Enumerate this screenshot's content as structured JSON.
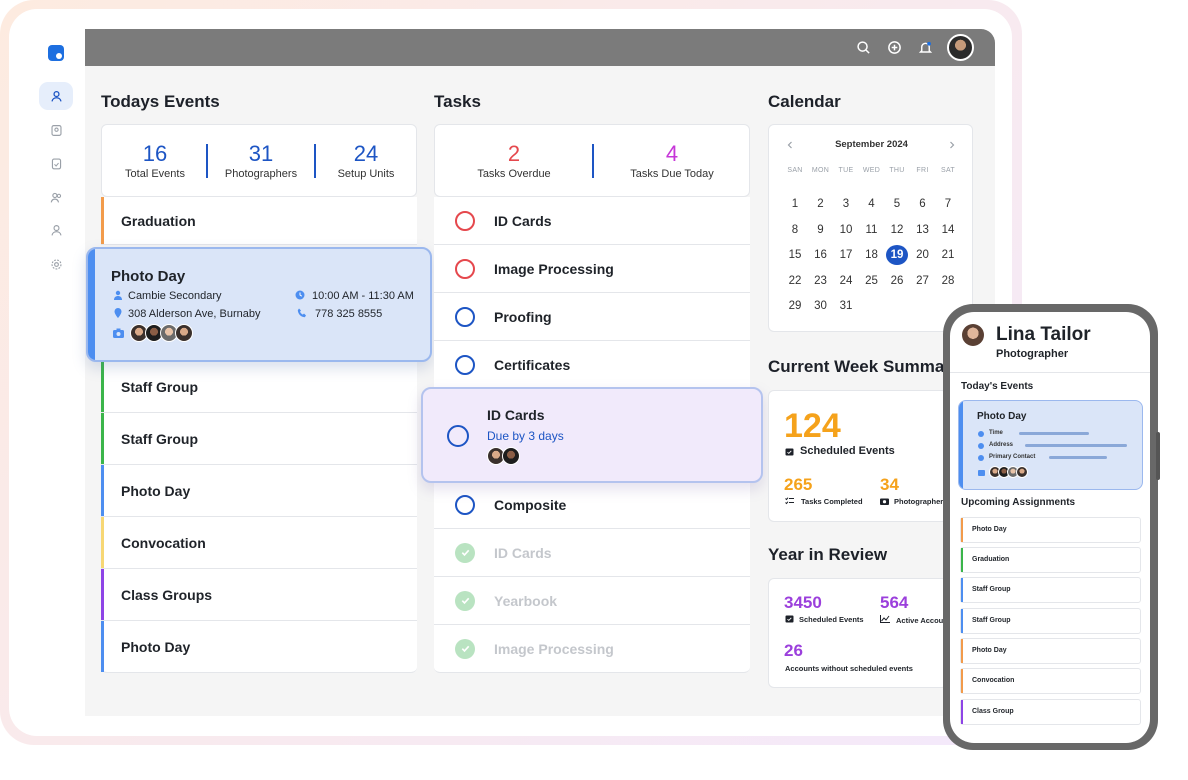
{
  "nav": {
    "items": [
      "user-icon",
      "id-badge-icon",
      "clipboard-icon",
      "users-icon",
      "person-icon",
      "gear-icon"
    ]
  },
  "topbar": {
    "icons": [
      "search-icon",
      "plus-circle-icon",
      "bell-icon"
    ]
  },
  "events": {
    "title": "Todays Events",
    "stats": [
      {
        "value": "16",
        "label": "Total Events"
      },
      {
        "value": "31",
        "label": "Photographers"
      },
      {
        "value": "24",
        "label": "Setup Units"
      }
    ],
    "rows": [
      {
        "label": "Graduation",
        "color": "#f29b4b"
      },
      {
        "label": "Staff Group",
        "color": "#3bb54a"
      },
      {
        "label": "Staff Group",
        "color": "#3bb54a"
      },
      {
        "label": "Photo Day",
        "color": "#4d8ef0"
      },
      {
        "label": "Convocation",
        "color": "#f7d774"
      },
      {
        "label": "Class Groups",
        "color": "#8e44e6"
      },
      {
        "label": "Photo Day",
        "color": "#4d8ef0"
      }
    ],
    "featured": {
      "title": "Photo Day",
      "location": "Cambie Secondary",
      "address": "308 Alderson Ave, Burnaby",
      "time": "10:00 AM - 11:30 AM",
      "phone": "778 325 8555"
    }
  },
  "tasks": {
    "title": "Tasks",
    "stats": [
      {
        "value": "2",
        "label": "Tasks Overdue",
        "color": "#e5484d"
      },
      {
        "value": "4",
        "label": "Tasks Due Today",
        "color": "#c636d8"
      }
    ],
    "rows": [
      {
        "label": "ID Cards",
        "state": "overdue"
      },
      {
        "label": "Image Processing",
        "state": "overdue"
      },
      {
        "label": "Proofing",
        "state": "open"
      },
      {
        "label": "Certificates",
        "state": "open"
      },
      {
        "label": "Composite",
        "state": "open"
      },
      {
        "label": "ID Cards",
        "state": "done"
      },
      {
        "label": "Yearbook",
        "state": "done"
      },
      {
        "label": "Image Processing",
        "state": "done"
      }
    ],
    "featured": {
      "title": "ID Cards",
      "due": "Due by 3 days"
    }
  },
  "calendar": {
    "title": "Calendar",
    "month": "September 2024",
    "days": [
      "SAN",
      "MON",
      "TUE",
      "WED",
      "THU",
      "FRI",
      "SAT"
    ],
    "weeks": [
      [
        "1",
        "2",
        "3",
        "4",
        "5",
        "6",
        "7"
      ],
      [
        "8",
        "9",
        "10",
        "11",
        "12",
        "13",
        "14"
      ],
      [
        "15",
        "16",
        "17",
        "18",
        "19",
        "20",
        "21"
      ],
      [
        "22",
        "23",
        "24",
        "25",
        "26",
        "27",
        "28"
      ],
      [
        "29",
        "30",
        "31",
        "",
        "",
        "",
        ""
      ]
    ],
    "today": "19"
  },
  "week": {
    "title": "Current Week Summary",
    "scheduled": "124",
    "scheduled_label": "Scheduled Events",
    "completed": "265",
    "completed_label": "Tasks Completed",
    "photographers": "34",
    "photographers_label": "Photographers"
  },
  "year": {
    "title": "Year in Review",
    "scheduled": "3450",
    "scheduled_label": "Scheduled Events",
    "active": "564",
    "active_label": "Active Accounts",
    "without": "26",
    "without_label": "Accounts without scheduled events"
  },
  "phone": {
    "name": "Lina Tailor",
    "role": "Photographer",
    "today_title": "Today's Events",
    "card_title": "Photo Day",
    "fields": [
      "Time",
      "Address",
      "Primary Contact"
    ],
    "upcoming_title": "Upcoming Assignments",
    "rows": [
      {
        "label": "Photo Day",
        "color": "#f29b4b"
      },
      {
        "label": "Graduation",
        "color": "#3bb54a"
      },
      {
        "label": "Staff Group",
        "color": "#4d8ef0"
      },
      {
        "label": "Staff Group",
        "color": "#4d8ef0"
      },
      {
        "label": "Photo Day",
        "color": "#f29b4b"
      },
      {
        "label": "Convocation",
        "color": "#f29b4b"
      },
      {
        "label": "Class Group",
        "color": "#8e44e6"
      }
    ]
  }
}
